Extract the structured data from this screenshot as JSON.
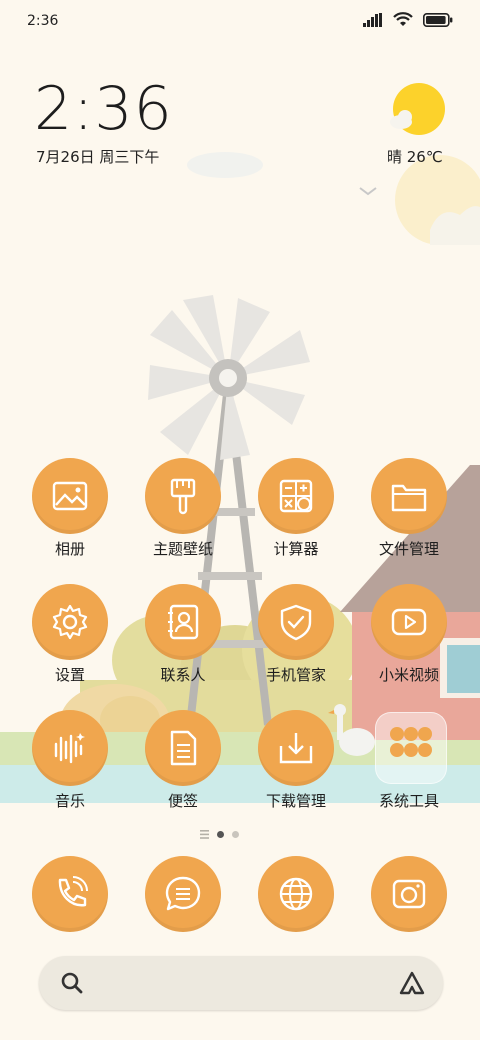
{
  "status_bar": {
    "time": "2:36",
    "battery_level": 0.95
  },
  "clock": {
    "time": "2:36",
    "date": "7月26日 周三下午"
  },
  "weather": {
    "text": "晴 26℃",
    "icon": "sun-with-cloud-icon"
  },
  "apps": [
    {
      "label": "相册",
      "icon": "photo-icon"
    },
    {
      "label": "主题壁纸",
      "icon": "paintbrush-icon"
    },
    {
      "label": "计算器",
      "icon": "calculator-icon"
    },
    {
      "label": "文件管理",
      "icon": "folder-icon"
    },
    {
      "label": "设置",
      "icon": "gear-icon"
    },
    {
      "label": "联系人",
      "icon": "contacts-book-icon"
    },
    {
      "label": "手机管家",
      "icon": "shield-check-icon"
    },
    {
      "label": "小米视频",
      "icon": "play-video-icon"
    },
    {
      "label": "音乐",
      "icon": "music-wave-icon"
    },
    {
      "label": "便签",
      "icon": "note-icon"
    },
    {
      "label": "下载管理",
      "icon": "download-tray-icon"
    },
    {
      "label": "系统工具",
      "icon": "folder-group-icon"
    }
  ],
  "pages": {
    "count": 2,
    "current": 1
  },
  "dock": [
    {
      "icon": "phone-icon"
    },
    {
      "icon": "message-bubble-icon"
    },
    {
      "icon": "globe-icon"
    },
    {
      "icon": "camera-icon"
    }
  ],
  "search": {
    "left_icon": "search-icon",
    "right_icon": "assistant-icon"
  },
  "colors": {
    "accent": "#f0a64e",
    "background": "#fdf8ee"
  }
}
